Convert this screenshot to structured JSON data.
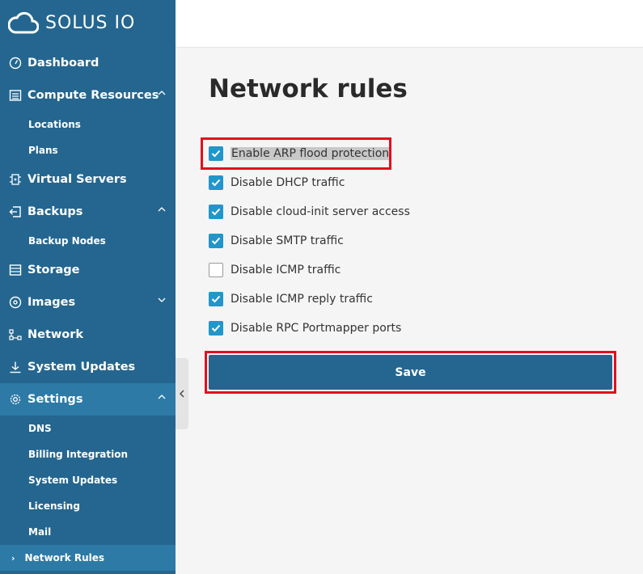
{
  "brand": {
    "name": "SOLUS IO"
  },
  "sidebar": {
    "items": [
      {
        "label": "Dashboard",
        "icon": "dashboard-icon"
      },
      {
        "label": "Compute Resources",
        "icon": "compute-resources-icon",
        "chevron": "up",
        "children": [
          {
            "label": "Locations"
          },
          {
            "label": "Plans"
          }
        ]
      },
      {
        "label": "Virtual Servers",
        "icon": "virtual-servers-icon"
      },
      {
        "label": "Backups",
        "icon": "backups-icon",
        "chevron": "up",
        "children": [
          {
            "label": "Backup Nodes"
          }
        ]
      },
      {
        "label": "Storage",
        "icon": "storage-icon"
      },
      {
        "label": "Images",
        "icon": "images-icon",
        "chevron": "down"
      },
      {
        "label": "Network",
        "icon": "network-icon"
      },
      {
        "label": "System Updates",
        "icon": "system-updates-icon"
      },
      {
        "label": "Settings",
        "icon": "settings-icon",
        "chevron": "up",
        "active": true,
        "children": [
          {
            "label": "DNS"
          },
          {
            "label": "Billing Integration"
          },
          {
            "label": "System Updates"
          },
          {
            "label": "Licensing"
          },
          {
            "label": "Mail"
          },
          {
            "label": "Network Rules",
            "active": true
          }
        ]
      }
    ]
  },
  "main": {
    "title": "Network rules",
    "rules": [
      {
        "label": "Enable ARP flood protection",
        "checked": true,
        "highlighted": true
      },
      {
        "label": "Disable DHCP traffic",
        "checked": true
      },
      {
        "label": "Disable cloud-init server access",
        "checked": true
      },
      {
        "label": "Disable SMTP traffic",
        "checked": true
      },
      {
        "label": "Disable ICMP traffic",
        "checked": false
      },
      {
        "label": "Disable ICMP reply traffic",
        "checked": true
      },
      {
        "label": "Disable RPC Portmapper ports",
        "checked": true
      }
    ],
    "save_label": "Save"
  },
  "colors": {
    "sidebar_bg": "#24668f",
    "sidebar_active": "#2d7aa6",
    "checkbox_on": "#2196c9",
    "save_button": "#24668f",
    "annotation_red": "#e0101e"
  }
}
